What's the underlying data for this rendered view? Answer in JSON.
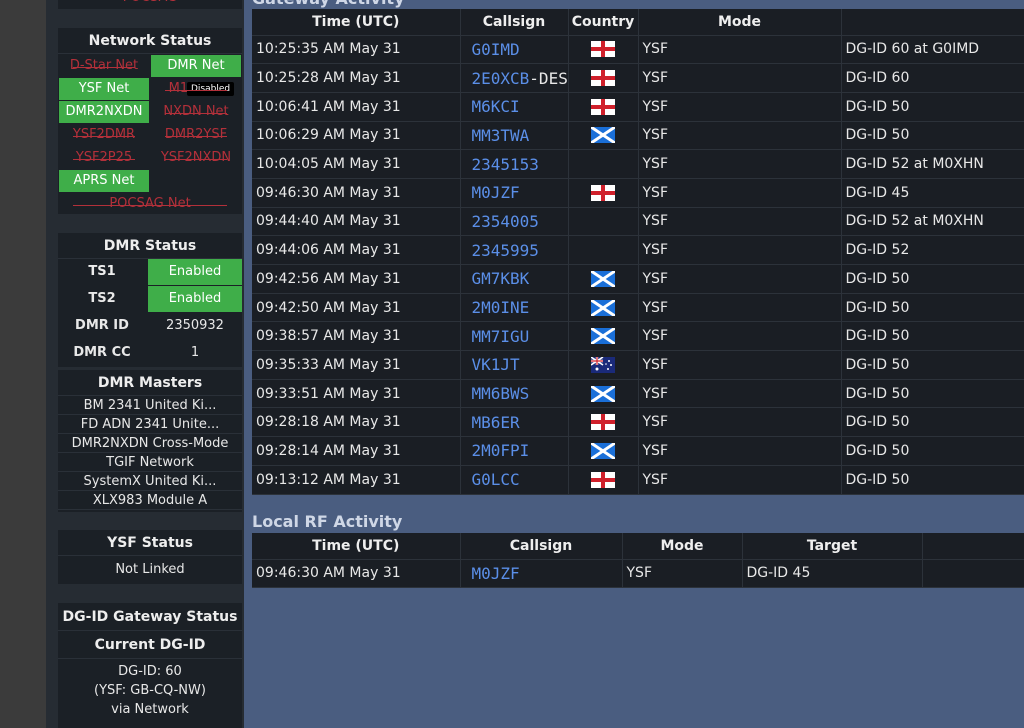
{
  "network": {
    "title": "Network Status",
    "top_partial": "POCSAG",
    "items": [
      {
        "label": "D-Star Net",
        "state": "off"
      },
      {
        "label": "DMR Net",
        "state": "on"
      },
      {
        "label": "YSF Net",
        "state": "on"
      },
      {
        "label": "M17 Net",
        "state": "off"
      },
      {
        "label": "DMR2NXDN",
        "state": "on"
      },
      {
        "label": "NXDN Net",
        "state": "off"
      },
      {
        "label": "YSF2DMR",
        "state": "off"
      },
      {
        "label": "DMR2YSF",
        "state": "off"
      },
      {
        "label": "YSF2P25",
        "state": "off"
      },
      {
        "label": "YSF2NXDN",
        "state": "off"
      },
      {
        "label": "APRS Net",
        "state": "on"
      },
      {
        "label": "POCSAG Net",
        "state": "off"
      }
    ],
    "tooltip": "Disabled"
  },
  "dmr": {
    "title": "DMR Status",
    "ts1_label": "TS1",
    "ts1_value": "Enabled",
    "ts2_label": "TS2",
    "ts2_value": "Enabled",
    "id_label": "DMR ID",
    "id_value": "2350932",
    "cc_label": "DMR CC",
    "cc_value": "1"
  },
  "masters": {
    "title": "DMR Masters",
    "items": [
      "BM 2341 United Ki...",
      "FD ADN 2341 Unite...",
      "DMR2NXDN Cross-Mode",
      "TGIF Network",
      "SystemX United Ki...",
      "XLX983 Module A"
    ]
  },
  "ysf": {
    "title": "YSF Status",
    "value": "Not Linked"
  },
  "dgid": {
    "title": "DG-ID Gateway Status",
    "current_title": "Current DG-ID",
    "line1": "DG-ID: 60",
    "line2": "(YSF: GB-CQ-NW)",
    "line3": "via Network"
  },
  "gateway": {
    "title": "Gateway Activity",
    "headers": [
      "Time (UTC)",
      "Callsign",
      "Country",
      "Mode",
      ""
    ],
    "rows": [
      {
        "time": "10:25:35 AM May 31",
        "call": "G0IMD",
        "suffix": "",
        "flag": "eng",
        "mode": "YSF",
        "target": "DG-ID 60 at G0IMD"
      },
      {
        "time": "10:25:28 AM May 31",
        "call": "2E0XCB",
        "suffix": "-DES",
        "flag": "eng",
        "mode": "YSF",
        "target": "DG-ID 60"
      },
      {
        "time": "10:06:41 AM May 31",
        "call": "M6KCI",
        "suffix": "",
        "flag": "eng",
        "mode": "YSF",
        "target": "DG-ID 50"
      },
      {
        "time": "10:06:29 AM May 31",
        "call": "MM3TWA",
        "suffix": "",
        "flag": "sco",
        "mode": "YSF",
        "target": "DG-ID 50"
      },
      {
        "time": "10:04:05 AM May 31",
        "call": "2345153",
        "suffix": "",
        "flag": "",
        "mode": "YSF",
        "target": "DG-ID 52 at M0XHN"
      },
      {
        "time": "09:46:30 AM May 31",
        "call": "M0JZF",
        "suffix": "",
        "flag": "eng",
        "mode": "YSF",
        "target": "DG-ID 45"
      },
      {
        "time": "09:44:40 AM May 31",
        "call": "2354005",
        "suffix": "",
        "flag": "",
        "mode": "YSF",
        "target": "DG-ID 52 at M0XHN"
      },
      {
        "time": "09:44:06 AM May 31",
        "call": "2345995",
        "suffix": "",
        "flag": "",
        "mode": "YSF",
        "target": "DG-ID 52"
      },
      {
        "time": "09:42:56 AM May 31",
        "call": "GM7KBK",
        "suffix": "",
        "flag": "sco",
        "mode": "YSF",
        "target": "DG-ID 50"
      },
      {
        "time": "09:42:50 AM May 31",
        "call": "2M0INE",
        "suffix": "",
        "flag": "sco",
        "mode": "YSF",
        "target": "DG-ID 50"
      },
      {
        "time": "09:38:57 AM May 31",
        "call": "MM7IGU",
        "suffix": "",
        "flag": "sco",
        "mode": "YSF",
        "target": "DG-ID 50"
      },
      {
        "time": "09:35:33 AM May 31",
        "call": "VK1JT",
        "suffix": "",
        "flag": "aus",
        "mode": "YSF",
        "target": "DG-ID 50"
      },
      {
        "time": "09:33:51 AM May 31",
        "call": "MM6BWS",
        "suffix": "",
        "flag": "sco",
        "mode": "YSF",
        "target": "DG-ID 50"
      },
      {
        "time": "09:28:18 AM May 31",
        "call": "MB6ER",
        "suffix": "",
        "flag": "eng",
        "mode": "YSF",
        "target": "DG-ID 50"
      },
      {
        "time": "09:28:14 AM May 31",
        "call": "2M0FPI",
        "suffix": "",
        "flag": "sco",
        "mode": "YSF",
        "target": "DG-ID 50"
      },
      {
        "time": "09:13:12 AM May 31",
        "call": "G0LCC",
        "suffix": "",
        "flag": "eng",
        "mode": "YSF",
        "target": "DG-ID 50"
      }
    ]
  },
  "local": {
    "title": "Local RF Activity",
    "headers": [
      "Time (UTC)",
      "Callsign",
      "Mode",
      "Target",
      ""
    ],
    "rows": [
      {
        "time": "09:46:30 AM May 31",
        "call": "M0JZF",
        "mode": "YSF",
        "target": "DG-ID 45"
      }
    ]
  },
  "colors": {
    "on": "#3fae49",
    "off": "#b3303a",
    "callsign": "#5b8fe8",
    "page_bg": "#4a5d80"
  }
}
